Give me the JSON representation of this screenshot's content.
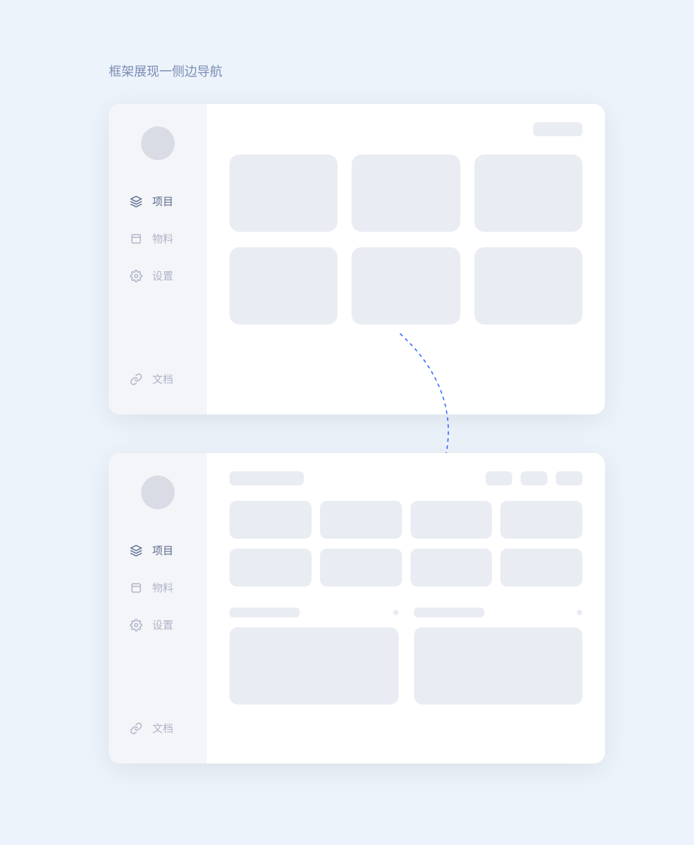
{
  "page_title": "框架展现一侧边导航",
  "sidebar": {
    "items": [
      {
        "label": "项目",
        "icon": "layers-icon",
        "active": true
      },
      {
        "label": "物料",
        "icon": "folder-icon",
        "active": false
      },
      {
        "label": "设置",
        "icon": "gear-icon",
        "active": false
      }
    ],
    "footer": {
      "label": "文档",
      "icon": "link-icon"
    }
  }
}
